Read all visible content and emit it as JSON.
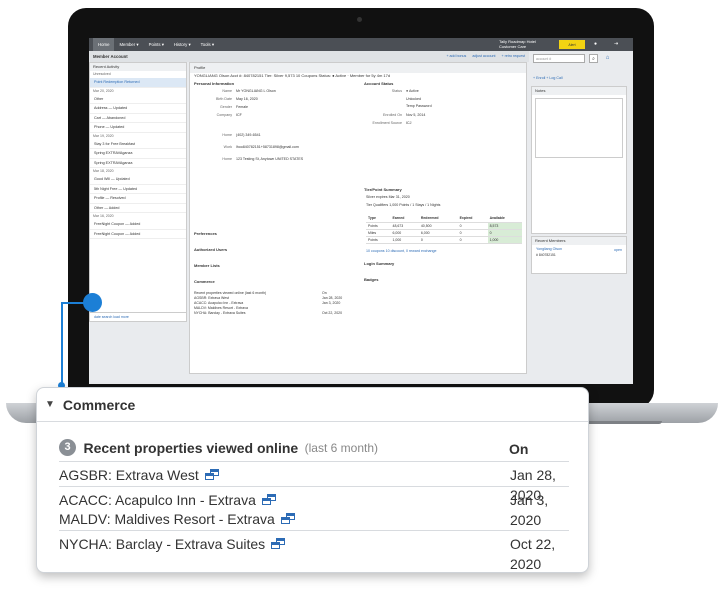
{
  "topnav": {
    "items": [
      "Home",
      "Member ▾",
      "Points ▾",
      "History ▾",
      "Tools ▾"
    ],
    "brand": "Tally Roadmap Hotel",
    "brand_sub": "Customer Care",
    "yellow_btn": "Alert"
  },
  "subbar": {
    "title": "Member Account",
    "actions": [
      "+ add bonus",
      "adjust account",
      "+ retro request"
    ]
  },
  "search": {
    "placeholder": "account #"
  },
  "member_header": "YONGLIANG Olson   Acct #: 840782151   Tier: Silver   9,573   10 Coupons   Status: ● Active · Member for 5y 4m 17d",
  "left": {
    "header": "Recent Activity",
    "unresolved": "Unresolved",
    "selected": "Point Redemption Returned",
    "rows": [
      {
        "date": "Mar 20, 2020"
      },
      {
        "label": "Other"
      },
      {
        "label": "Address — Updated"
      },
      {
        "label": "Cart — Abandoned"
      },
      {
        "label": "Phone — Updated"
      },
      {
        "date": "Mar 19, 2020"
      },
      {
        "label": "Stay 3 for Free Breakfast"
      },
      {
        "label": "Spring EXTRAVAganza"
      },
      {
        "label": "Spring EXTRAVAganza"
      },
      {
        "date": "Mar 18, 2020"
      },
      {
        "label": "Good Will — Updated"
      },
      {
        "label": "5th Night Free — Updated"
      },
      {
        "label": "Profile — Resolved"
      },
      {
        "label": "Other — Added"
      },
      {
        "date": "Mar 16, 2020"
      },
      {
        "label": "FreeNight Coupon — Added"
      },
      {
        "label": "FreeNight Coupon — Added"
      }
    ],
    "footer": "date search   load more"
  },
  "center": {
    "bar": "Profile",
    "personal": "Personal Information",
    "fields": [
      {
        "k": "Name",
        "v": "Mr YONGLIANG L Olson"
      },
      {
        "k": "Birth Date",
        "v": "May 16, 2020"
      },
      {
        "k": "Gender",
        "v": "Female"
      },
      {
        "k": "Company",
        "v": "ICF"
      },
      {
        "k": "Home",
        "v": "(402) 349-6541"
      },
      {
        "k": "Work",
        "v": "lhoo840782151+58731898@gmail.com"
      },
      {
        "k": "Home",
        "v": "123 Testing St, Anytown UNITED STATES"
      }
    ],
    "account_status": "Account Status",
    "status_fields": [
      {
        "k": "Status",
        "v": "● Active"
      },
      {
        "k": "",
        "v": "Unlocked"
      },
      {
        "k": "",
        "v": "Temp Password"
      },
      {
        "k": "Enrolled On",
        "v": "Nov 5, 2014"
      },
      {
        "k": "Enrollment Source",
        "v": "ICJ"
      }
    ],
    "tier_summary": "Tier/Point Summary",
    "tier_line": "Silver expires Mar 31, 2020",
    "tier_qual": "Tier Qualifiers   1,000 Points  /  1 Stays  /  1 Nights",
    "points_table": {
      "headers": [
        "Type",
        "Earned",
        "Redeemed",
        "Expired",
        "Available"
      ],
      "rows": [
        [
          "Points",
          "48,673",
          "40,500",
          "0",
          "8,573"
        ],
        [
          "Miles",
          "6,000",
          "6,000",
          "0",
          "0"
        ],
        [
          "Points",
          "1,000",
          "0",
          "0",
          "1,000"
        ]
      ]
    },
    "coupons_line": "10 coupons   10 discount, 0 reward exchange",
    "sections": [
      "Preferences",
      "Authorized Users",
      "Member Lists",
      "Commerce"
    ],
    "login_summary": "Login Summary",
    "badges": "Badges",
    "mini_commerce": {
      "head": "Recent properties viewed online (last 6 month)",
      "on": "On",
      "rows": [
        [
          "AGSBR: Extrava West",
          "Jan 28, 2020"
        ],
        [
          "ACACC: Acapulco Inn - Extrava",
          "Jan 3, 2020"
        ],
        [
          "MALDV: Maldives Resort - Extrava",
          ""
        ],
        [
          "NYCHA: Barclay - Extrava Suites",
          "Oct 22, 2020"
        ]
      ]
    }
  },
  "right": {
    "enroll": "+ Enroll   + Log Call",
    "notes": "Notes",
    "recent_members": "Recent Members",
    "member": "Yongliang Olson",
    "member_acct": "# 840782151",
    "open": "open"
  },
  "callout": {
    "title": "Commerce",
    "count": "3",
    "label": "Recent properties viewed online",
    "sublabel": "(last 6 month)",
    "on_header": "On",
    "rows": [
      {
        "names": [
          "AGSBR: Extrava West"
        ],
        "date": "Jan 28, 2020"
      },
      {
        "names": [
          "ACACC: Acapulco Inn - Extrava",
          "MALDV: Maldives Resort - Extrava"
        ],
        "date": "Jan 3, 2020"
      },
      {
        "names": [
          "NYCHA: Barclay - Extrava Suites"
        ],
        "date": "Oct 22, 2020"
      }
    ]
  },
  "colors": {
    "accent": "#1c7fd6",
    "link": "#2c6bb5",
    "nav": "#4b4f55",
    "yellow": "#f2d312"
  }
}
